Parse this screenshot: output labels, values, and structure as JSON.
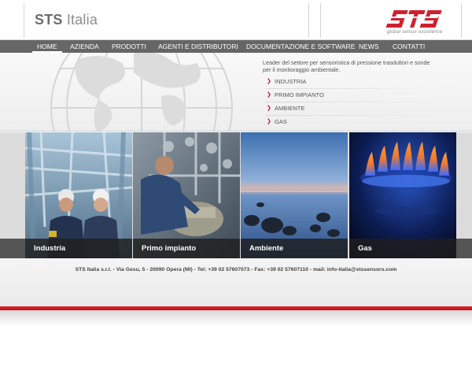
{
  "header": {
    "brand_bold": "STS",
    "brand_light": "Italia",
    "logo_text": "STS",
    "logo_tagline": "global sensor excellence",
    "logo_color": "#c8102e"
  },
  "nav": {
    "items": [
      {
        "label": "HOME",
        "active": true
      },
      {
        "label": "AZIENDA"
      },
      {
        "label": "PRODOTTI"
      },
      {
        "label": "AGENTI E DISTRIBUTORI"
      },
      {
        "label": "DOCUMENTAZIONE E SOFTWARE"
      },
      {
        "label": "NEWS"
      },
      {
        "label": "CONTATTI"
      }
    ]
  },
  "hero": {
    "intro": "Leader del settore per sensoristica di pressione trasduttori e sonde per il monitoraggio ambientale.",
    "links": [
      {
        "label": "INDUSTRIA"
      },
      {
        "label": "PRIMO IMPIANTO"
      },
      {
        "label": "AMBIENTE"
      },
      {
        "label": "GAS"
      }
    ],
    "link_icon": "chevron-right-icon",
    "accent_color": "#c8102e"
  },
  "tiles": [
    {
      "caption": "Industria",
      "image": "industrial-workers-photo"
    },
    {
      "caption": "Primo impianto",
      "image": "technician-machinery-photo"
    },
    {
      "caption": "Ambiente",
      "image": "lake-rocks-photo"
    },
    {
      "caption": "Gas",
      "image": "gas-flame-photo"
    }
  ],
  "footer": {
    "text": "STS Italia s.r.l. - Via Gesu, 5 - 20090 Opera (MI) - Tel: +39 02 57607073 - Fax: +39 02 57607110 - mail: info-italia@stssensors.com",
    "bar_color": "#c8102e"
  }
}
